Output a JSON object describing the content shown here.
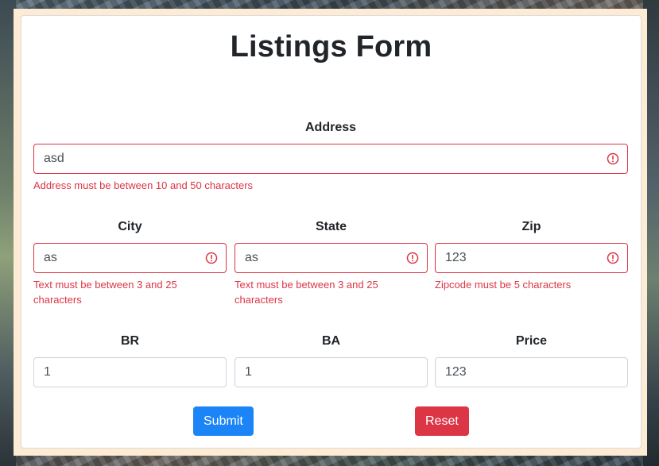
{
  "page": {
    "title": "Listings Form"
  },
  "fields": {
    "address": {
      "label": "Address",
      "value": "asd",
      "error": "Address must be between 10 and 50 characters"
    },
    "city": {
      "label": "City",
      "value": "as",
      "error": "Text must be between 3 and 25 characters"
    },
    "state": {
      "label": "State",
      "value": "as",
      "error": "Text must be between 3 and 25 characters"
    },
    "zip": {
      "label": "Zip",
      "value": "123",
      "error": "Zipcode must be 5 characters"
    },
    "br": {
      "label": "BR",
      "value": "1"
    },
    "ba": {
      "label": "BA",
      "value": "1"
    },
    "price": {
      "label": "Price",
      "value": "123"
    }
  },
  "buttons": {
    "submit": "Submit",
    "reset": "Reset"
  },
  "colors": {
    "error": "#dc3545",
    "primary": "#1b85f8",
    "frame": "#fdebd3",
    "text": "#212529"
  },
  "icons": {
    "invalid": "alert-circle-icon"
  }
}
